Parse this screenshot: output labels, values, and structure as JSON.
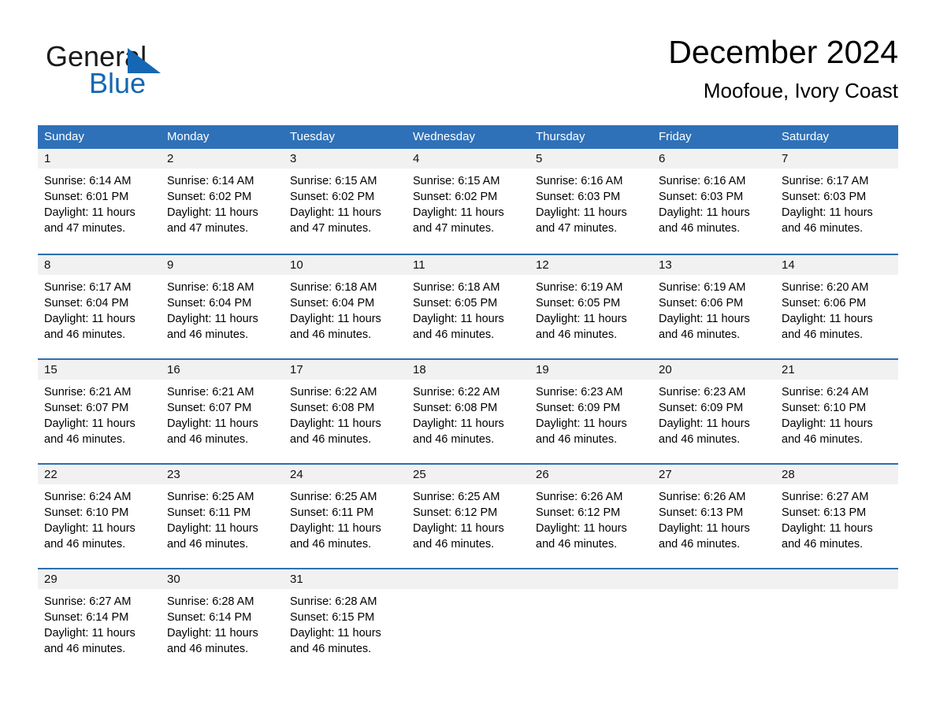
{
  "brand": {
    "name_top": "General",
    "name_bottom": "Blue",
    "triangle_color": "#1567b3",
    "text_color": "#1a1a1a"
  },
  "header": {
    "title": "December 2024",
    "subtitle": "Moofoue, Ivory Coast"
  },
  "colors": {
    "header_blue": "#2e71b8",
    "row_rule_blue": "#2e6fae",
    "daynum_band": "#f1f1f1",
    "page_background": "#ffffff"
  },
  "weekdays": [
    "Sunday",
    "Monday",
    "Tuesday",
    "Wednesday",
    "Thursday",
    "Friday",
    "Saturday"
  ],
  "weeks": [
    [
      {
        "day": "1",
        "sunrise": "Sunrise: 6:14 AM",
        "sunset": "Sunset: 6:01 PM",
        "daylight_line1": "Daylight: 11 hours",
        "daylight_line2": "and 47 minutes."
      },
      {
        "day": "2",
        "sunrise": "Sunrise: 6:14 AM",
        "sunset": "Sunset: 6:02 PM",
        "daylight_line1": "Daylight: 11 hours",
        "daylight_line2": "and 47 minutes."
      },
      {
        "day": "3",
        "sunrise": "Sunrise: 6:15 AM",
        "sunset": "Sunset: 6:02 PM",
        "daylight_line1": "Daylight: 11 hours",
        "daylight_line2": "and 47 minutes."
      },
      {
        "day": "4",
        "sunrise": "Sunrise: 6:15 AM",
        "sunset": "Sunset: 6:02 PM",
        "daylight_line1": "Daylight: 11 hours",
        "daylight_line2": "and 47 minutes."
      },
      {
        "day": "5",
        "sunrise": "Sunrise: 6:16 AM",
        "sunset": "Sunset: 6:03 PM",
        "daylight_line1": "Daylight: 11 hours",
        "daylight_line2": "and 47 minutes."
      },
      {
        "day": "6",
        "sunrise": "Sunrise: 6:16 AM",
        "sunset": "Sunset: 6:03 PM",
        "daylight_line1": "Daylight: 11 hours",
        "daylight_line2": "and 46 minutes."
      },
      {
        "day": "7",
        "sunrise": "Sunrise: 6:17 AM",
        "sunset": "Sunset: 6:03 PM",
        "daylight_line1": "Daylight: 11 hours",
        "daylight_line2": "and 46 minutes."
      }
    ],
    [
      {
        "day": "8",
        "sunrise": "Sunrise: 6:17 AM",
        "sunset": "Sunset: 6:04 PM",
        "daylight_line1": "Daylight: 11 hours",
        "daylight_line2": "and 46 minutes."
      },
      {
        "day": "9",
        "sunrise": "Sunrise: 6:18 AM",
        "sunset": "Sunset: 6:04 PM",
        "daylight_line1": "Daylight: 11 hours",
        "daylight_line2": "and 46 minutes."
      },
      {
        "day": "10",
        "sunrise": "Sunrise: 6:18 AM",
        "sunset": "Sunset: 6:04 PM",
        "daylight_line1": "Daylight: 11 hours",
        "daylight_line2": "and 46 minutes."
      },
      {
        "day": "11",
        "sunrise": "Sunrise: 6:18 AM",
        "sunset": "Sunset: 6:05 PM",
        "daylight_line1": "Daylight: 11 hours",
        "daylight_line2": "and 46 minutes."
      },
      {
        "day": "12",
        "sunrise": "Sunrise: 6:19 AM",
        "sunset": "Sunset: 6:05 PM",
        "daylight_line1": "Daylight: 11 hours",
        "daylight_line2": "and 46 minutes."
      },
      {
        "day": "13",
        "sunrise": "Sunrise: 6:19 AM",
        "sunset": "Sunset: 6:06 PM",
        "daylight_line1": "Daylight: 11 hours",
        "daylight_line2": "and 46 minutes."
      },
      {
        "day": "14",
        "sunrise": "Sunrise: 6:20 AM",
        "sunset": "Sunset: 6:06 PM",
        "daylight_line1": "Daylight: 11 hours",
        "daylight_line2": "and 46 minutes."
      }
    ],
    [
      {
        "day": "15",
        "sunrise": "Sunrise: 6:21 AM",
        "sunset": "Sunset: 6:07 PM",
        "daylight_line1": "Daylight: 11 hours",
        "daylight_line2": "and 46 minutes."
      },
      {
        "day": "16",
        "sunrise": "Sunrise: 6:21 AM",
        "sunset": "Sunset: 6:07 PM",
        "daylight_line1": "Daylight: 11 hours",
        "daylight_line2": "and 46 minutes."
      },
      {
        "day": "17",
        "sunrise": "Sunrise: 6:22 AM",
        "sunset": "Sunset: 6:08 PM",
        "daylight_line1": "Daylight: 11 hours",
        "daylight_line2": "and 46 minutes."
      },
      {
        "day": "18",
        "sunrise": "Sunrise: 6:22 AM",
        "sunset": "Sunset: 6:08 PM",
        "daylight_line1": "Daylight: 11 hours",
        "daylight_line2": "and 46 minutes."
      },
      {
        "day": "19",
        "sunrise": "Sunrise: 6:23 AM",
        "sunset": "Sunset: 6:09 PM",
        "daylight_line1": "Daylight: 11 hours",
        "daylight_line2": "and 46 minutes."
      },
      {
        "day": "20",
        "sunrise": "Sunrise: 6:23 AM",
        "sunset": "Sunset: 6:09 PM",
        "daylight_line1": "Daylight: 11 hours",
        "daylight_line2": "and 46 minutes."
      },
      {
        "day": "21",
        "sunrise": "Sunrise: 6:24 AM",
        "sunset": "Sunset: 6:10 PM",
        "daylight_line1": "Daylight: 11 hours",
        "daylight_line2": "and 46 minutes."
      }
    ],
    [
      {
        "day": "22",
        "sunrise": "Sunrise: 6:24 AM",
        "sunset": "Sunset: 6:10 PM",
        "daylight_line1": "Daylight: 11 hours",
        "daylight_line2": "and 46 minutes."
      },
      {
        "day": "23",
        "sunrise": "Sunrise: 6:25 AM",
        "sunset": "Sunset: 6:11 PM",
        "daylight_line1": "Daylight: 11 hours",
        "daylight_line2": "and 46 minutes."
      },
      {
        "day": "24",
        "sunrise": "Sunrise: 6:25 AM",
        "sunset": "Sunset: 6:11 PM",
        "daylight_line1": "Daylight: 11 hours",
        "daylight_line2": "and 46 minutes."
      },
      {
        "day": "25",
        "sunrise": "Sunrise: 6:25 AM",
        "sunset": "Sunset: 6:12 PM",
        "daylight_line1": "Daylight: 11 hours",
        "daylight_line2": "and 46 minutes."
      },
      {
        "day": "26",
        "sunrise": "Sunrise: 6:26 AM",
        "sunset": "Sunset: 6:12 PM",
        "daylight_line1": "Daylight: 11 hours",
        "daylight_line2": "and 46 minutes."
      },
      {
        "day": "27",
        "sunrise": "Sunrise: 6:26 AM",
        "sunset": "Sunset: 6:13 PM",
        "daylight_line1": "Daylight: 11 hours",
        "daylight_line2": "and 46 minutes."
      },
      {
        "day": "28",
        "sunrise": "Sunrise: 6:27 AM",
        "sunset": "Sunset: 6:13 PM",
        "daylight_line1": "Daylight: 11 hours",
        "daylight_line2": "and 46 minutes."
      }
    ],
    [
      {
        "day": "29",
        "sunrise": "Sunrise: 6:27 AM",
        "sunset": "Sunset: 6:14 PM",
        "daylight_line1": "Daylight: 11 hours",
        "daylight_line2": "and 46 minutes."
      },
      {
        "day": "30",
        "sunrise": "Sunrise: 6:28 AM",
        "sunset": "Sunset: 6:14 PM",
        "daylight_line1": "Daylight: 11 hours",
        "daylight_line2": "and 46 minutes."
      },
      {
        "day": "31",
        "sunrise": "Sunrise: 6:28 AM",
        "sunset": "Sunset: 6:15 PM",
        "daylight_line1": "Daylight: 11 hours",
        "daylight_line2": "and 46 minutes."
      },
      {
        "day": "",
        "sunrise": "",
        "sunset": "",
        "daylight_line1": "",
        "daylight_line2": ""
      },
      {
        "day": "",
        "sunrise": "",
        "sunset": "",
        "daylight_line1": "",
        "daylight_line2": ""
      },
      {
        "day": "",
        "sunrise": "",
        "sunset": "",
        "daylight_line1": "",
        "daylight_line2": ""
      },
      {
        "day": "",
        "sunrise": "",
        "sunset": "",
        "daylight_line1": "",
        "daylight_line2": ""
      }
    ]
  ]
}
